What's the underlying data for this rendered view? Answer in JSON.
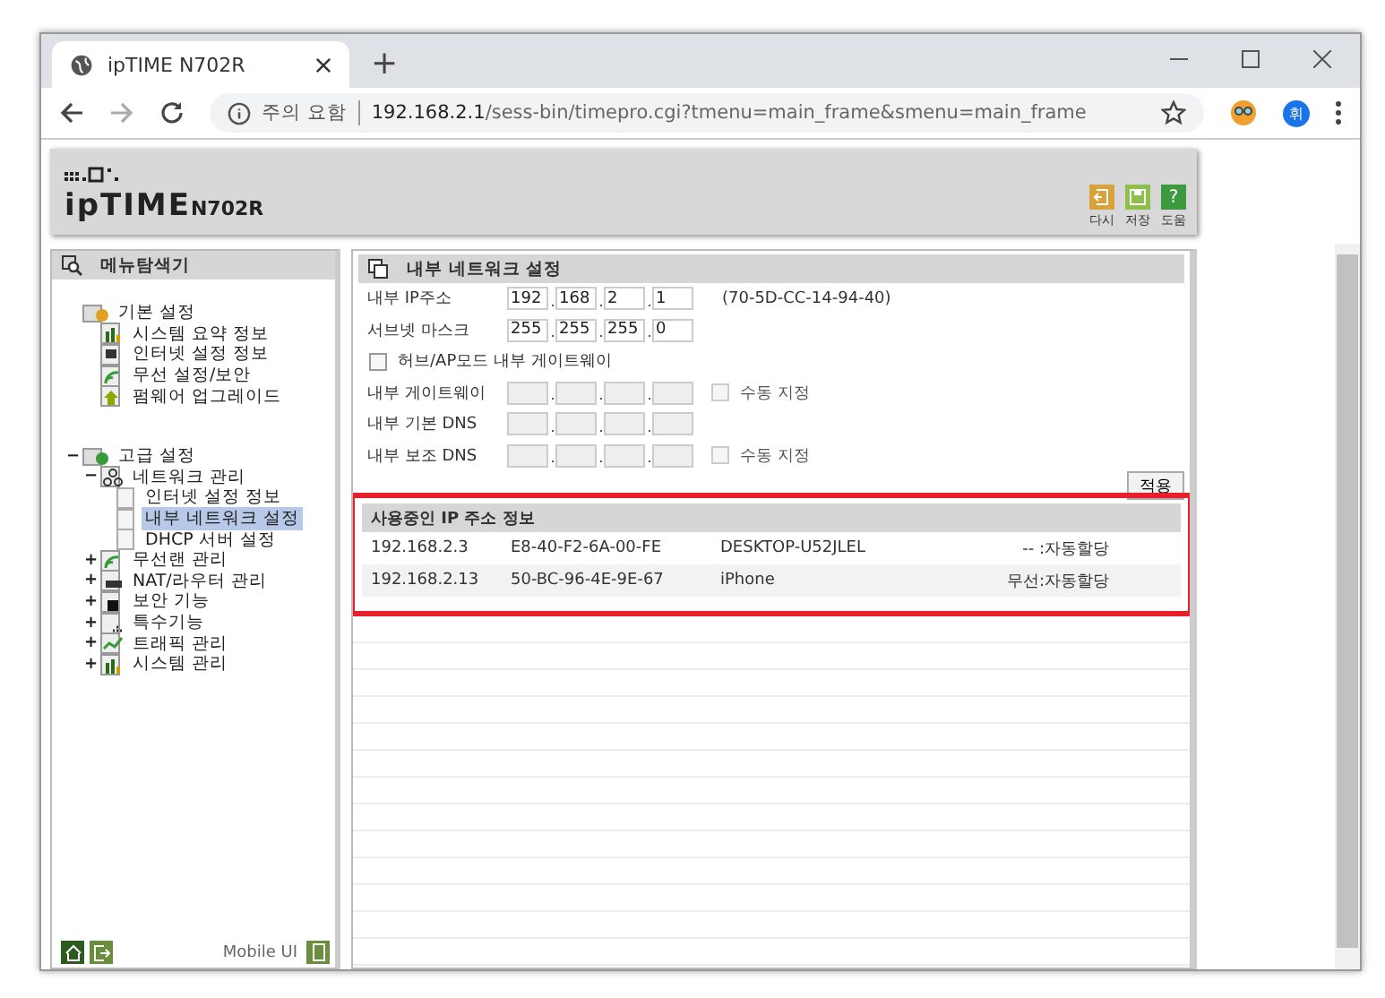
{
  "browser": {
    "tab_title": "ipTIME N702R",
    "new_tab": "+",
    "security": "주의 요함",
    "url_host": "192.168.2.1",
    "url_path": "/sess-bin/timepro.cgi?tmenu=main_frame&smenu=main_frame",
    "profile": "휘"
  },
  "header": {
    "logo": "ipTIME",
    "model": "N702R",
    "actions": [
      {
        "kind": "refresh",
        "label": "다시"
      },
      {
        "kind": "save",
        "label": "저장"
      },
      {
        "kind": "help",
        "label": "도움",
        "glyph": "?"
      }
    ]
  },
  "sidebar": {
    "title": "메뉴탐색기",
    "groups": [
      {
        "label": "기본 설정",
        "children": [
          {
            "label": "시스템 요약 정보",
            "kind": "chart"
          },
          {
            "label": "인터넷 설정 정보",
            "kind": "monitor"
          },
          {
            "label": "무선 설정/보안",
            "kind": "wifi"
          },
          {
            "label": "펌웨어 업그레이드",
            "kind": "upgrade"
          }
        ]
      },
      {
        "label": "고급 설정",
        "toggle": "−",
        "children": [
          {
            "label": "네트워크 관리",
            "kind": "network",
            "toggle": "−",
            "children": [
              {
                "label": "인터넷 설정 정보",
                "selected": false
              },
              {
                "label": "내부 네트워크 설정",
                "selected": true
              },
              {
                "label": "DHCP 서버 설정",
                "selected": false
              }
            ]
          },
          {
            "label": "무선랜 관리",
            "kind": "wifi",
            "toggle": "+"
          },
          {
            "label": "NAT/라우터 관리",
            "kind": "router",
            "toggle": "+"
          },
          {
            "label": "보안 기능",
            "kind": "lock",
            "toggle": "+"
          },
          {
            "label": "특수기능",
            "kind": "special",
            "toggle": "+"
          },
          {
            "label": "트래픽 관리",
            "kind": "traffic",
            "toggle": "+"
          },
          {
            "label": "시스템 관리",
            "kind": "chart",
            "toggle": "+"
          }
        ]
      }
    ],
    "footer": {
      "mobile": "Mobile UI"
    }
  },
  "settings": {
    "title": "내부 네트워크 설정",
    "rows": [
      {
        "kind": "ip",
        "label": "내부 IP주소",
        "octets": [
          "192",
          "168",
          "2",
          "1"
        ],
        "disabled": false,
        "note": "(70-5D-CC-14-94-40)"
      },
      {
        "kind": "ip",
        "label": "서브넷 마스크",
        "octets": [
          "255",
          "255",
          "255",
          "0"
        ],
        "disabled": false
      },
      {
        "kind": "check",
        "label": "허브/AP모드 내부 게이트웨이",
        "checked": false
      },
      {
        "kind": "ip",
        "label": "내부 게이트웨이",
        "disabled": true,
        "manual": {
          "label": "수동 지정",
          "checked": false
        }
      },
      {
        "kind": "ip",
        "label": "내부 기본 DNS",
        "disabled": true
      },
      {
        "kind": "ip",
        "label": "내부 보조 DNS",
        "disabled": true,
        "manual": {
          "label": "수동 지정",
          "checked": false
        }
      }
    ],
    "apply": "적용"
  },
  "leases": {
    "title": "사용중인 IP 주소 정보",
    "highlighted": true,
    "rows": [
      {
        "ip": "192.168.2.3",
        "mac": "E8-40-F2-6A-00-FE",
        "host": "DESKTOP-U52JLEL",
        "type": "-- :자동할당"
      },
      {
        "ip": "192.168.2.13",
        "mac": "50-BC-96-4E-9E-67",
        "host": "iPhone",
        "type": "무선:자동할당"
      }
    ]
  }
}
